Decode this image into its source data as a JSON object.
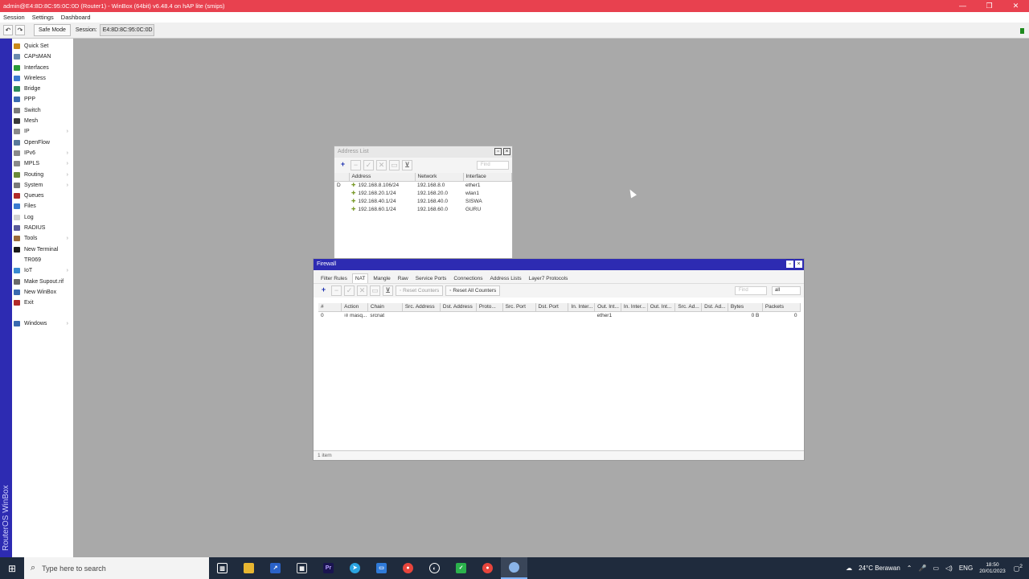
{
  "window": {
    "title": "admin@E4:8D:8C:95:0C:0D (Router1) - WinBox (64bit) v6.48.4 on hAP lite (smips)",
    "controls": [
      "—",
      "❐",
      "✕"
    ]
  },
  "menu": [
    "Session",
    "Settings",
    "Dashboard"
  ],
  "toolbar": {
    "undo": "↶",
    "redo": "↷",
    "safe_mode": "Safe Mode",
    "session_label": "Session:",
    "session_value": "E4:8D:8C:95:0C:0D"
  },
  "sidebar": {
    "vertical_label": "RouterOS WinBox",
    "items": [
      {
        "label": "Quick Set",
        "icon": "wand-icon",
        "color": "#c98a1a",
        "arrow": ""
      },
      {
        "label": "CAPsMAN",
        "icon": "capsman-icon",
        "color": "#6a8ab0",
        "arrow": ""
      },
      {
        "label": "Interfaces",
        "icon": "interfaces-icon",
        "color": "#2a9a3a",
        "arrow": ""
      },
      {
        "label": "Wireless",
        "icon": "wireless-icon",
        "color": "#3a7ad0",
        "arrow": ""
      },
      {
        "label": "Bridge",
        "icon": "bridge-icon",
        "color": "#2a8a5a",
        "arrow": ""
      },
      {
        "label": "PPP",
        "icon": "ppp-icon",
        "color": "#3a6ab0",
        "arrow": ""
      },
      {
        "label": "Switch",
        "icon": "switch-icon",
        "color": "#7a7a7a",
        "arrow": ""
      },
      {
        "label": "Mesh",
        "icon": "mesh-icon",
        "color": "#3a3a3a",
        "arrow": ""
      },
      {
        "label": "IP",
        "icon": "ip-icon",
        "color": "#8a8a8a",
        "arrow": "›"
      },
      {
        "label": "OpenFlow",
        "icon": "openflow-icon",
        "color": "#5a7a9a",
        "arrow": ""
      },
      {
        "label": "IPv6",
        "icon": "ipv6-icon",
        "color": "#8a8a8a",
        "arrow": "›"
      },
      {
        "label": "MPLS",
        "icon": "mpls-icon",
        "color": "#8a8a8a",
        "arrow": "›"
      },
      {
        "label": "Routing",
        "icon": "routing-icon",
        "color": "#6a8a3a",
        "arrow": "›"
      },
      {
        "label": "System",
        "icon": "system-icon",
        "color": "#7a7a7a",
        "arrow": "›"
      },
      {
        "label": "Queues",
        "icon": "queues-icon",
        "color": "#b02a2a",
        "arrow": ""
      },
      {
        "label": "Files",
        "icon": "files-icon",
        "color": "#3a7ad0",
        "arrow": ""
      },
      {
        "label": "Log",
        "icon": "log-icon",
        "color": "#d0d0d0",
        "arrow": ""
      },
      {
        "label": "RADIUS",
        "icon": "radius-icon",
        "color": "#5a5a9a",
        "arrow": ""
      },
      {
        "label": "Tools",
        "icon": "tools-icon",
        "color": "#9a6a3a",
        "arrow": "›"
      },
      {
        "label": "New Terminal",
        "icon": "terminal-icon",
        "color": "#1a1a1a",
        "arrow": ""
      },
      {
        "label": "TR069",
        "icon": "tr069-icon",
        "color": "#ffffff",
        "arrow": ""
      },
      {
        "label": "IoT",
        "icon": "iot-icon",
        "color": "#3a8ad0",
        "arrow": "›"
      },
      {
        "label": "Make Supout.rif",
        "icon": "supout-icon",
        "color": "#6a6a6a",
        "arrow": ""
      },
      {
        "label": "New WinBox",
        "icon": "winbox-icon",
        "color": "#3a6ab0",
        "arrow": ""
      },
      {
        "label": "Exit",
        "icon": "exit-icon",
        "color": "#b02a2a",
        "arrow": ""
      }
    ],
    "windows_item": {
      "label": "Windows",
      "arrow": "›"
    }
  },
  "address_list": {
    "title": "Address List",
    "find_placeholder": "Find",
    "columns": [
      "",
      "Address",
      "Network",
      "Interface"
    ],
    "rows": [
      {
        "flag": "D",
        "address": "192.168.8.106/24",
        "network": "192.168.8.0",
        "interface": "ether1"
      },
      {
        "flag": "",
        "address": "192.168.20.1/24",
        "network": "192.168.20.0",
        "interface": "wlan1"
      },
      {
        "flag": "",
        "address": "192.168.40.1/24",
        "network": "192.168.40.0",
        "interface": "SISWA"
      },
      {
        "flag": "",
        "address": "192.168.60.1/24",
        "network": "192.168.60.0",
        "interface": "GURU"
      }
    ]
  },
  "firewall": {
    "title": "Firewall",
    "tabs": [
      "Filter Rules",
      "NAT",
      "Mangle",
      "Raw",
      "Service Ports",
      "Connections",
      "Address Lists",
      "Layer7 Protocols"
    ],
    "active_tab": "NAT",
    "reset_counters": "Reset Counters",
    "reset_all_counters": "Reset All Counters",
    "find_placeholder": "Find",
    "filter_value": "all",
    "columns": [
      "#",
      "Action",
      "Chain",
      "Src. Address",
      "Dst. Address",
      "Proto...",
      "Src. Port",
      "Dst. Port",
      "In. Inter...",
      "Out. Int...",
      "In. Inter...",
      "Out. Int...",
      "Src. Ad...",
      "Dst. Ad...",
      "Bytes",
      "Packets"
    ],
    "rows": [
      {
        "num": "0",
        "action": "masq...",
        "chain": "srcnat",
        "out_int": "ether1",
        "bytes": "0 B",
        "packets": "0"
      }
    ],
    "status": "1 item"
  },
  "taskbar": {
    "search_placeholder": "Type here to search",
    "weather": "24°C  Berawan",
    "lang": "ENG",
    "time": "18:50",
    "date": "20/01/2023",
    "notifications_count": "2"
  }
}
